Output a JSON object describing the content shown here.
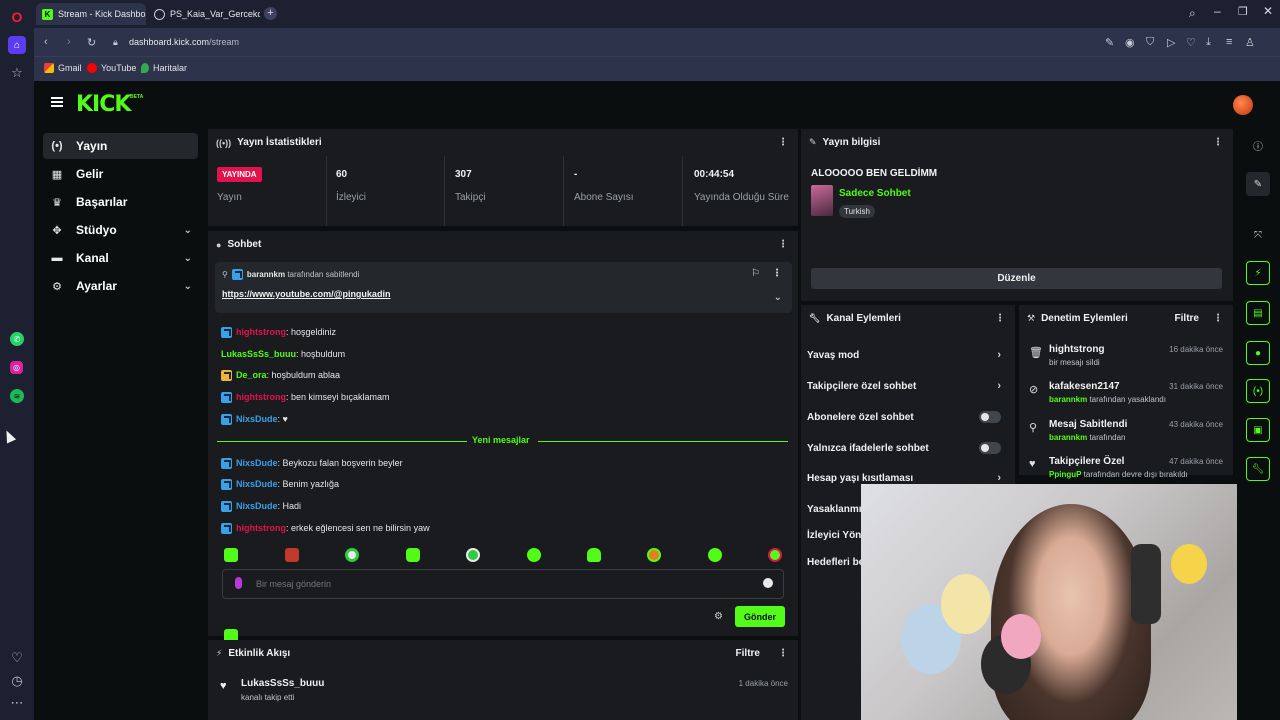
{
  "browser": {
    "tabs": [
      {
        "label": "Stream - Kick Dashboard",
        "active": true
      },
      {
        "label": "PS_Kaia_Var_Gercekci_Port",
        "active": false
      }
    ],
    "url_domain": "dashboard.kick.com",
    "url_path": "/stream",
    "bookmarks": [
      "Gmail",
      "YouTube",
      "Haritalar"
    ]
  },
  "kick": {
    "logo": "KICK",
    "logo_badge": "BETA",
    "nav": [
      {
        "label": "Yayın",
        "icon": "broadcast-icon",
        "active": true,
        "expandable": false
      },
      {
        "label": "Gelir",
        "icon": "income-icon",
        "active": false,
        "expandable": false
      },
      {
        "label": "Başarılar",
        "icon": "trophy-icon",
        "active": false,
        "expandable": false
      },
      {
        "label": "Stüdyo",
        "icon": "studio-icon",
        "active": false,
        "expandable": true
      },
      {
        "label": "Kanal",
        "icon": "channel-icon",
        "active": false,
        "expandable": true
      },
      {
        "label": "Ayarlar",
        "icon": "settings-icon",
        "active": false,
        "expandable": true
      }
    ]
  },
  "stats_panel": {
    "title": "Yayın İstatistikleri",
    "live_badge": "YAYINDA",
    "live_label": "Yayın",
    "cells": [
      {
        "value": "60",
        "label": "İzleyici"
      },
      {
        "value": "307",
        "label": "Takipçi"
      },
      {
        "value": "-",
        "label": "Abone Sayısı"
      },
      {
        "value": "00:44:54",
        "label": "Yayında Olduğu Süre"
      }
    ]
  },
  "chat_panel": {
    "title": "Sohbet",
    "pinned_by": "barannkm",
    "pinned_suffix": "tarafından sabitlendi",
    "pinned_link": "https://www.youtube.com/@pingukadin",
    "messages_before": [
      {
        "user": "hightstrong",
        "color": "#e2134b",
        "badge": "blue",
        "text": ": hoşgeldiniz"
      },
      {
        "user": "LukasSsSs_buuu",
        "color": "#53fc18",
        "badge": "",
        "text": ": hoşbuldum"
      },
      {
        "user": "De_ora",
        "color": "#53fc18",
        "badge": "gold",
        "text": ": hoşbuldum ablaa"
      },
      {
        "user": "hightstrong",
        "color": "#e2134b",
        "badge": "blue",
        "text": ": ben kimseyi bıçaklamam"
      },
      {
        "user": "NixsDude",
        "color": "#3aa0e8",
        "badge": "blue",
        "text": ": ♥"
      }
    ],
    "new_messages_label": "Yeni mesajlar",
    "messages_after": [
      {
        "user": "NixsDude",
        "color": "#3aa0e8",
        "badge": "blue",
        "text": ": Beykozu falan boşverin beyler"
      },
      {
        "user": "NixsDude",
        "color": "#3aa0e8",
        "badge": "blue",
        "text": ": Benim yazlığa"
      },
      {
        "user": "NixsDude",
        "color": "#3aa0e8",
        "badge": "blue",
        "text": ": Hadi"
      },
      {
        "user": "hightstrong",
        "color": "#e2134b",
        "badge": "blue",
        "text": ": erkek eğlencesi sen ne bilirsin yaw"
      }
    ],
    "input_placeholder": "Bir mesaj gönderin",
    "send_label": "Gönder"
  },
  "activity_panel": {
    "title": "Etkinlik Akışı",
    "filter_label": "Filtre",
    "items": [
      {
        "user": "LukasSsSs_buuu",
        "text": "kanalı takip etti",
        "time": "1 dakika önce"
      }
    ]
  },
  "stream_info": {
    "title": "Yayın bilgisi",
    "stream_title": "ALOOOOO BEN GELDİMM",
    "category": "Sadece Sohbet",
    "language": "Turkish",
    "edit_label": "Düzenle"
  },
  "channel_actions": {
    "title": "Kanal Eylemleri",
    "items": [
      {
        "label": "Yavaş mod",
        "control": "chevron"
      },
      {
        "label": "Takipçilere özel sohbet",
        "control": "chevron"
      },
      {
        "label": "Abonelere özel sohbet",
        "control": "toggle"
      },
      {
        "label": "Yalnızca ifadelerle sohbet",
        "control": "toggle"
      },
      {
        "label": "Hesap yaşı kısıtlaması",
        "control": "chevron"
      },
      {
        "label": "Yasaklanmış",
        "control": ""
      },
      {
        "label": "İzleyici Yönl",
        "control": ""
      },
      {
        "label": "Hedefleri be",
        "control": ""
      }
    ]
  },
  "mod_actions": {
    "title": "Denetim Eylemleri",
    "filter_label": "Filtre",
    "items": [
      {
        "title": "hightstrong",
        "time": "16 dakika önce",
        "actor": "",
        "sub": "bir mesajı sildi",
        "icon": "trash-icon"
      },
      {
        "title": "kafakesen2147",
        "time": "31 dakika önce",
        "actor": "barannkm",
        "sub": " tarafından yasaklandı",
        "icon": "ban-icon"
      },
      {
        "title": "Mesaj Sabitlendi",
        "time": "43 dakika önce",
        "actor": "barannkm",
        "sub": " tarafından",
        "icon": "pin-icon"
      },
      {
        "title": "Takipçilere Özel",
        "time": "47 dakika önce",
        "actor": "PpinguP",
        "sub": " tarafından devre dışı bırakıldı",
        "icon": "heart-icon"
      }
    ]
  },
  "colors": {
    "kick_green": "#53fc18",
    "live_red": "#e2134b",
    "panel_bg": "#191b1f",
    "page_bg": "#0b0e0f"
  }
}
